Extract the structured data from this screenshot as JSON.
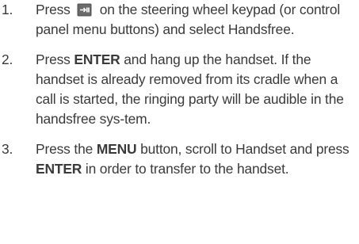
{
  "steps": [
    {
      "number": "1.",
      "part1": "Press",
      "icon": "phone-menu-key-icon",
      "part2": "on the steering wheel keypad (or control panel menu buttons) and select Handsfree."
    },
    {
      "number": "2.",
      "part1": "Press",
      "kw1": "ENTER",
      "part2": "and hang up the handset. If the handset is already removed from its cradle when a call is started, the ringing party will be audible in the handsfree sys-tem."
    },
    {
      "number": "3.",
      "part1": "Press the",
      "kw1": "MENU",
      "part2": "button, scroll to Handset and press",
      "kw2": "ENTER",
      "part3": "in order to transfer to the handset."
    }
  ],
  "colors": {
    "text": "#3a3a3a",
    "icon_fill": "#5a5a5a"
  }
}
